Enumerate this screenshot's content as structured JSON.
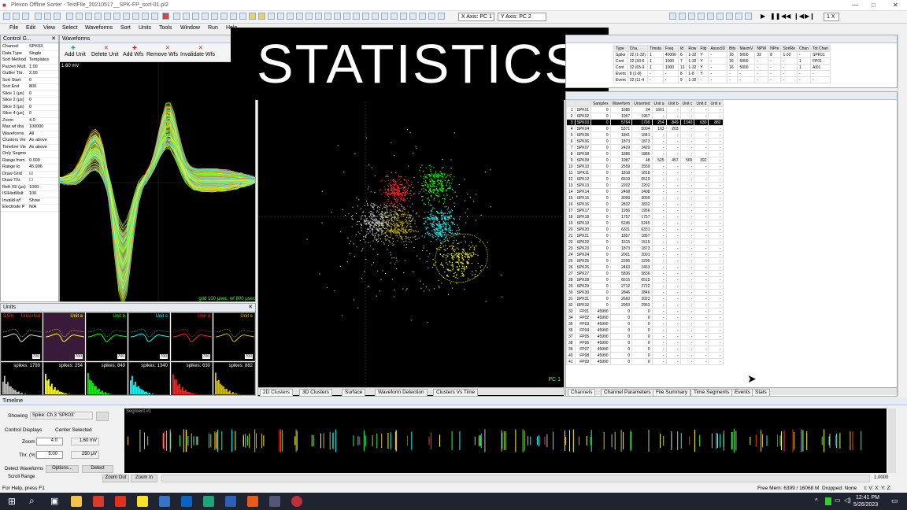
{
  "app": {
    "title": "Plexon Offline Sorter - TestFile_20210517__SPK-FP_sort-01.pl2"
  },
  "overlay": {
    "text": "STATISTICS"
  },
  "toolbar": {
    "x_axis": "X Axis: PC 1",
    "y_axis": "Y Axis: PC 2",
    "speed": "1 X"
  },
  "menu": [
    "File",
    "Edit",
    "View",
    "Select",
    "Waveforms",
    "Sort",
    "Units",
    "Tools",
    "Window",
    "Run",
    "Help"
  ],
  "control_grid": {
    "title": "Control G...",
    "rows": [
      {
        "k": "Channel",
        "v": "SPK03"
      },
      {
        "k": "Data Type",
        "v": "Single"
      },
      {
        "k": "Sort Method",
        "v": "Templates"
      },
      {
        "k": "Parzen Mult.",
        "v": "1.00"
      },
      {
        "k": "Outlier Thr.",
        "v": "2.00"
      },
      {
        "k": "Sort Start",
        "v": "0"
      },
      {
        "k": "Sort End",
        "v": "800"
      },
      {
        "k": "Slice 1 (μs)",
        "v": "0"
      },
      {
        "k": "Slice 2 (μs)",
        "v": "0"
      },
      {
        "k": "Slice 3 (μs)",
        "v": "0"
      },
      {
        "k": "Slice 4 (μs)",
        "v": "0"
      },
      {
        "k": "Zoom",
        "v": "4.0"
      },
      {
        "k": "Max wf dra",
        "v": "100000"
      },
      {
        "k": "Waveforms",
        "v": "All"
      },
      {
        "k": "Clusters Vie",
        "v": "As above"
      },
      {
        "k": "Timeline Vie",
        "v": "As above"
      },
      {
        "k": "Only Segme",
        "v": ""
      },
      {
        "k": "Range from",
        "v": "0.000"
      },
      {
        "k": "Range to",
        "v": "45.996"
      },
      {
        "k": "Draw Grid",
        "v": "☑"
      },
      {
        "k": "Draw Thr.",
        "v": "☐"
      },
      {
        "k": "Refr ISI (μs)",
        "v": "1000"
      },
      {
        "k": "ISIHistMult",
        "v": "100"
      },
      {
        "k": "Invalid wf",
        "v": "Show"
      },
      {
        "k": "Electrode P",
        "v": "N/A"
      }
    ]
  },
  "waveforms": {
    "title": "Waveforms",
    "tools": [
      "Add Unit",
      "Delete Unit",
      "Add Wfs",
      "Remove Wfs",
      "Invalidate Wfs"
    ],
    "scale": "1.60 mV",
    "footer": "grid 100 μsec, wf 800 μsec"
  },
  "units_panel": {
    "title": "Units",
    "cells": [
      {
        "label": "Unsorted",
        "pct": "3.5%",
        "spikes": "spikes: 1799",
        "color": "#ff3030"
      },
      {
        "label": "Unit a",
        "spikes": "spikes: 254",
        "color": "#ffff00"
      },
      {
        "label": "Unit b",
        "spikes": "spikes: 849",
        "color": "#00ff00"
      },
      {
        "label": "Unit c",
        "spikes": "spikes: 1340",
        "color": "#00ffff"
      },
      {
        "label": "Unit d",
        "spikes": "spikes: 630",
        "color": "#ff2020"
      },
      {
        "label": "Unit e",
        "spikes": "spikes: 882",
        "color": "#d8c000"
      }
    ],
    "count_label": "700"
  },
  "cluster_view": {
    "axis_label": "PC 1",
    "tabs": [
      "2D Clusters",
      "3D Clusters",
      "Surface",
      "Waveform Detection",
      "Clusters Vs Time"
    ]
  },
  "summary_table": {
    "headers": [
      "Type",
      "Cha..",
      "Timsta",
      "Freq",
      "Id",
      "Row",
      "Flip",
      "AssocID",
      "Bits",
      "MaxmV",
      "NPW",
      "NPre",
      "SortRe",
      "Chan",
      "Tot Chan"
    ],
    "rows": [
      [
        "Spike",
        "32 (1-32)",
        "1",
        "40000",
        "6",
        "1-32",
        "Y",
        "-",
        "16",
        "5000",
        "32",
        "8",
        "1-32",
        "-",
        "SPK01"
      ],
      [
        "Cont",
        "32 (33-6",
        "1",
        "1000",
        "7",
        "1-32",
        "Y",
        "-",
        "16",
        "5000",
        "-",
        "-",
        "-",
        "1",
        "FP01"
      ],
      [
        "Cont",
        "32 (65-9",
        "1",
        "1000",
        "13",
        "1-32",
        "Y",
        "-",
        "16",
        "5000",
        "-",
        "-",
        "-",
        "1",
        "AI01"
      ],
      [
        "Event",
        "8 (1-8)",
        "-",
        "-",
        "8",
        "1-8",
        "Y",
        "-",
        "-",
        "-",
        "-",
        "-",
        "-",
        "-",
        "-"
      ],
      [
        "Event",
        "32 (11-4",
        "-",
        "-",
        "9",
        "1-32",
        "-",
        "-",
        "-",
        "-",
        "-",
        "-",
        "-",
        "-",
        "-"
      ]
    ]
  },
  "channel_table": {
    "headers": [
      "",
      "",
      "Samples",
      "Waveform",
      "Unsorted",
      "Unit a",
      "Unit b",
      "Unit c",
      "Unit d",
      "Unit e"
    ],
    "rows": [
      [
        "1",
        "SPK01",
        "0",
        "1685",
        "24",
        "1661",
        "-",
        "-",
        "-",
        "-"
      ],
      [
        "2",
        "SPK02",
        "0",
        "1957",
        "1957",
        "-",
        "-",
        "-",
        "-",
        "-"
      ],
      [
        "3",
        "SPK03",
        "0",
        "5764",
        "1799",
        "254",
        "849",
        "1340",
        "630",
        "882"
      ],
      [
        "4",
        "SPK04",
        "0",
        "5371",
        "5004",
        "163",
        "203",
        "-",
        "-",
        "-"
      ],
      [
        "5",
        "SPK05",
        "0",
        "1841",
        "1841",
        "-",
        "-",
        "-",
        "-",
        "-"
      ],
      [
        "6",
        "SPK06",
        "0",
        "1873",
        "1873",
        "-",
        "-",
        "-",
        "-",
        "-"
      ],
      [
        "7",
        "SPK07",
        "0",
        "2429",
        "2429",
        "-",
        "-",
        "-",
        "-",
        "-"
      ],
      [
        "8",
        "SPK08",
        "0",
        "1886",
        "1886",
        "-",
        "-",
        "-",
        "-",
        "-"
      ],
      [
        "9",
        "SPK09",
        "0",
        "1987",
        "48",
        "525",
        "457",
        "565",
        "392",
        "-"
      ],
      [
        "10",
        "SPK10",
        "0",
        "2559",
        "2559",
        "-",
        "-",
        "-",
        "-",
        "-"
      ],
      [
        "11",
        "SPK11",
        "0",
        "1818",
        "1818",
        "-",
        "-",
        "-",
        "-",
        "-"
      ],
      [
        "12",
        "SPK12",
        "0",
        "6519",
        "6519",
        "-",
        "-",
        "-",
        "-",
        "-"
      ],
      [
        "13",
        "SPK13",
        "0",
        "2202",
        "2202",
        "-",
        "-",
        "-",
        "-",
        "-"
      ],
      [
        "14",
        "SPK14",
        "0",
        "2408",
        "2408",
        "-",
        "-",
        "-",
        "-",
        "-"
      ],
      [
        "15",
        "SPK15",
        "0",
        "3099",
        "3099",
        "-",
        "-",
        "-",
        "-",
        "-"
      ],
      [
        "16",
        "SPK16",
        "0",
        "2832",
        "2832",
        "-",
        "-",
        "-",
        "-",
        "-"
      ],
      [
        "17",
        "SPK17",
        "0",
        "1956",
        "1956",
        "-",
        "-",
        "-",
        "-",
        "-"
      ],
      [
        "18",
        "SPK18",
        "0",
        "1757",
        "1757",
        "-",
        "-",
        "-",
        "-",
        "-"
      ],
      [
        "19",
        "SPK19",
        "0",
        "5245",
        "5245",
        "-",
        "-",
        "-",
        "-",
        "-"
      ],
      [
        "20",
        "SPK20",
        "0",
        "6331",
        "6331",
        "-",
        "-",
        "-",
        "-",
        "-"
      ],
      [
        "21",
        "SPK21",
        "0",
        "1857",
        "1857",
        "-",
        "-",
        "-",
        "-",
        "-"
      ],
      [
        "22",
        "SPK22",
        "0",
        "1515",
        "1515",
        "-",
        "-",
        "-",
        "-",
        "-"
      ],
      [
        "23",
        "SPK23",
        "0",
        "1873",
        "1873",
        "-",
        "-",
        "-",
        "-",
        "-"
      ],
      [
        "24",
        "SPK24",
        "0",
        "2001",
        "2001",
        "-",
        "-",
        "-",
        "-",
        "-"
      ],
      [
        "25",
        "SPK25",
        "0",
        "2295",
        "2295",
        "-",
        "-",
        "-",
        "-",
        "-"
      ],
      [
        "26",
        "SPK26",
        "0",
        "2463",
        "2463",
        "-",
        "-",
        "-",
        "-",
        "-"
      ],
      [
        "27",
        "SPK27",
        "0",
        "5836",
        "5836",
        "-",
        "-",
        "-",
        "-",
        "-"
      ],
      [
        "28",
        "SPK28",
        "0",
        "6515",
        "6515",
        "-",
        "-",
        "-",
        "-",
        "-"
      ],
      [
        "29",
        "SPK29",
        "0",
        "2712",
        "2712",
        "-",
        "-",
        "-",
        "-",
        "-"
      ],
      [
        "30",
        "SPK30",
        "0",
        "2846",
        "2846",
        "-",
        "-",
        "-",
        "-",
        "-"
      ],
      [
        "31",
        "SPK31",
        "0",
        "2660",
        "2023",
        "-",
        "-",
        "-",
        "-",
        "-"
      ],
      [
        "32",
        "SPK32",
        "0",
        "2953",
        "2953",
        "-",
        "-",
        "-",
        "-",
        "-"
      ],
      [
        "33",
        "FP01",
        "45990",
        "0",
        "0",
        "-",
        "-",
        "-",
        "-",
        "-"
      ],
      [
        "34",
        "FP02",
        "45990",
        "0",
        "0",
        "-",
        "-",
        "-",
        "-",
        "-"
      ],
      [
        "35",
        "FP03",
        "45990",
        "0",
        "0",
        "-",
        "-",
        "-",
        "-",
        "-"
      ],
      [
        "36",
        "FP04",
        "45990",
        "0",
        "0",
        "-",
        "-",
        "-",
        "-",
        "-"
      ],
      [
        "37",
        "FP05",
        "45990",
        "0",
        "0",
        "-",
        "-",
        "-",
        "-",
        "-"
      ],
      [
        "38",
        "FP06",
        "45990",
        "0",
        "0",
        "-",
        "-",
        "-",
        "-",
        "-"
      ],
      [
        "39",
        "FP07",
        "45990",
        "0",
        "0",
        "-",
        "-",
        "-",
        "-",
        "-"
      ],
      [
        "40",
        "FP08",
        "45990",
        "0",
        "0",
        "-",
        "-",
        "-",
        "-",
        "-"
      ],
      [
        "41",
        "FP09",
        "45990",
        "0",
        "0",
        "-",
        "-",
        "-",
        "-",
        "-"
      ]
    ],
    "tabs": [
      "Channels",
      "Channel Parameters",
      "File Summary",
      "Time Segments",
      "Events",
      "Stats"
    ]
  },
  "timeline": {
    "title": "Timeline",
    "showing_label": "Showing",
    "showing_value": "Spike: Ch 3 'SPK03'",
    "control_displays": "Control Displays",
    "center_selected": "Center Selected",
    "zoom_label": "Zoom",
    "zoom_value": "4.0",
    "zoom_mv": "1.60 mV",
    "thr_label": "Thr. (%)",
    "thr_value": "5.00",
    "thr_uv": "250 μV",
    "detect_label": "Detect Waveforms",
    "options": "Options...",
    "detect": "Detect",
    "scroll_label": "Scroll Range",
    "zoom_out": "Zoom Out",
    "zoom_in": "Zoom In",
    "segment": "Segment #1",
    "scroll_value": "1.0000"
  },
  "status": {
    "help": "For Help, press F1",
    "mem": "Free Mem: 6399 / 16068 M",
    "dropped": "Dropped: None",
    "coords": "t:  V:  X:  Y:  Z:"
  },
  "taskbar": {
    "time": "12:41 PM",
    "date": "5/26/2023"
  }
}
